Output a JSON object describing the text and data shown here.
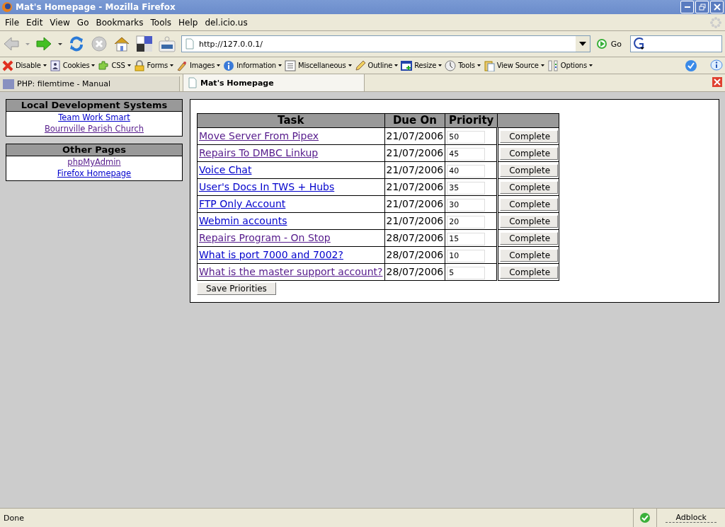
{
  "window": {
    "title": "Mat's Homepage - Mozilla Firefox"
  },
  "menu": [
    "File",
    "Edit",
    "View",
    "Go",
    "Bookmarks",
    "Tools",
    "Help",
    "del.icio.us"
  ],
  "navigation": {
    "url": "http://127.0.0.1/",
    "go_label": "Go"
  },
  "extensions_toolbar": [
    {
      "label": "Disable",
      "kind": "cross"
    },
    {
      "label": "Cookies",
      "kind": "person"
    },
    {
      "label": "CSS",
      "kind": "puzzle"
    },
    {
      "label": "Forms",
      "kind": "lock"
    },
    {
      "label": "Images",
      "kind": "brush"
    },
    {
      "label": "Information",
      "kind": "info"
    },
    {
      "label": "Miscellaneous",
      "kind": "list"
    },
    {
      "label": "Outline",
      "kind": "pencil"
    },
    {
      "label": "Resize",
      "kind": "window"
    },
    {
      "label": "Tools",
      "kind": "clock"
    },
    {
      "label": "View Source",
      "kind": "clipboard"
    },
    {
      "label": "Options",
      "kind": "ruler"
    }
  ],
  "tabs": [
    {
      "label": "PHP: filemtime - Manual",
      "selected": false,
      "kind": "php"
    },
    {
      "label": "Mat's Homepage",
      "selected": true,
      "kind": "page"
    }
  ],
  "sidebar": [
    {
      "title": "Local Development Systems",
      "links": [
        {
          "label": "Team Work Smart",
          "visited": false
        },
        {
          "label": "Bournville Parish Church",
          "visited": true
        }
      ]
    },
    {
      "title": "Other Pages",
      "links": [
        {
          "label": "phpMyAdmin",
          "visited": true
        },
        {
          "label": "Firefox Homepage",
          "visited": false
        }
      ]
    }
  ],
  "table": {
    "columns": [
      "Task",
      "Due On",
      "Priority"
    ],
    "rows": [
      {
        "task": "Move Server From Pipex",
        "visited": true,
        "due": "21/07/2006",
        "priority": "50",
        "action": "Complete"
      },
      {
        "task": "Repairs To DMBC Linkup",
        "visited": true,
        "due": "21/07/2006",
        "priority": "45",
        "action": "Complete"
      },
      {
        "task": "Voice Chat",
        "visited": false,
        "due": "21/07/2006",
        "priority": "40",
        "action": "Complete"
      },
      {
        "task": "User's Docs In TWS + Hubs",
        "visited": false,
        "due": "21/07/2006",
        "priority": "35",
        "action": "Complete"
      },
      {
        "task": "FTP Only Account",
        "visited": false,
        "due": "21/07/2006",
        "priority": "30",
        "action": "Complete"
      },
      {
        "task": "Webmin accounts",
        "visited": false,
        "due": "21/07/2006",
        "priority": "20",
        "action": "Complete"
      },
      {
        "task": "Repairs Program - On Stop",
        "visited": true,
        "due": "28/07/2006",
        "priority": "15",
        "action": "Complete"
      },
      {
        "task": "What is port 7000 and 7002?",
        "visited": false,
        "due": "28/07/2006",
        "priority": "10",
        "action": "Complete"
      },
      {
        "task": "What is the master support account?",
        "visited": true,
        "due": "28/07/2006",
        "priority": "5",
        "action": "Complete"
      }
    ]
  },
  "save_button": "Save Priorities",
  "status_bar": {
    "text": "Done",
    "adblock": "Adblock"
  }
}
